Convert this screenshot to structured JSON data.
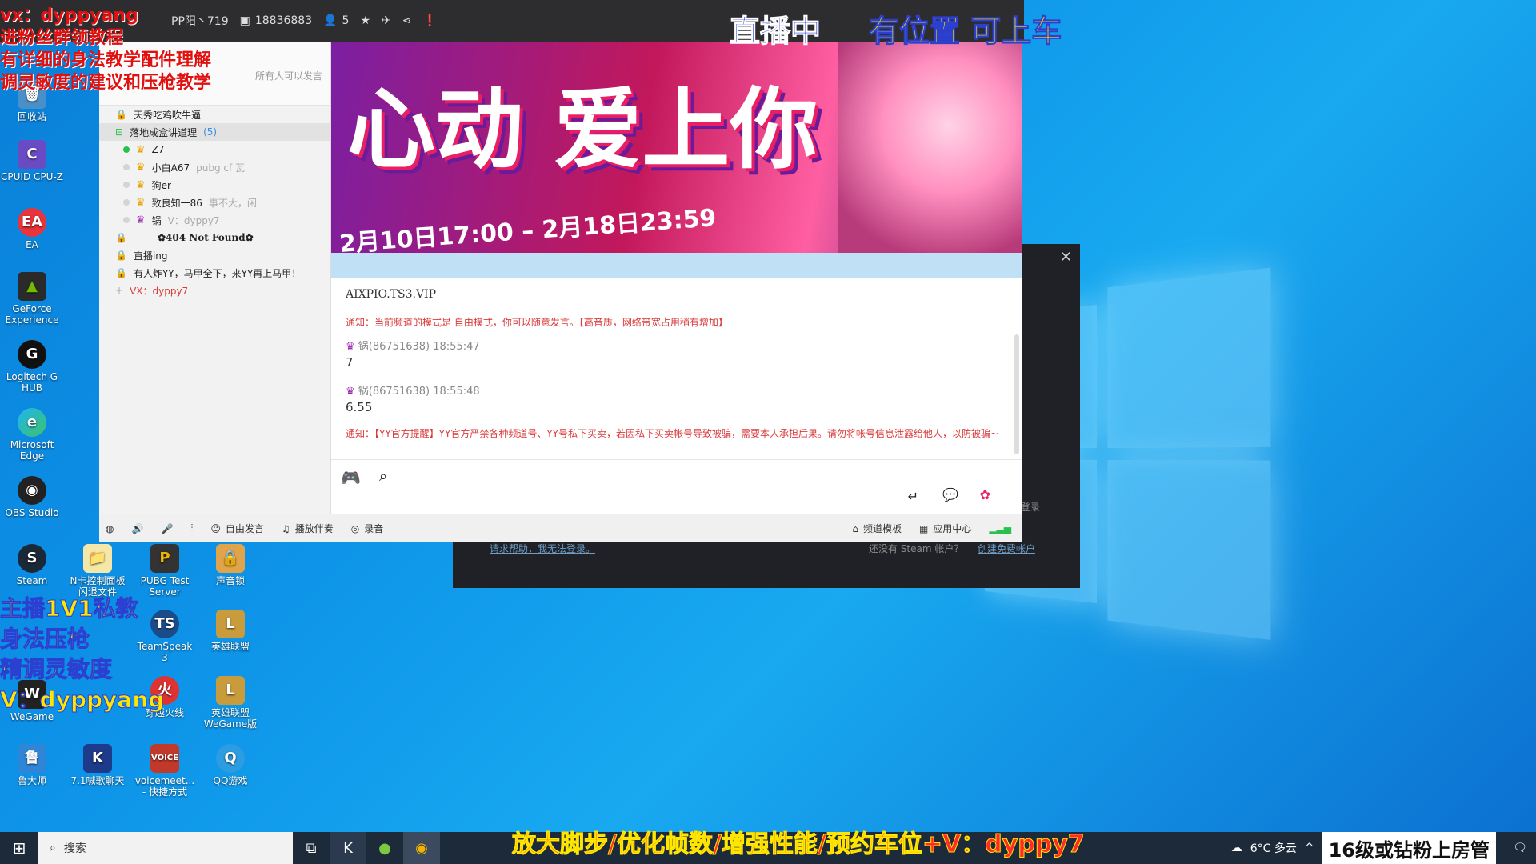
{
  "overlay": {
    "red_lines": [
      "vx：dyppyang",
      "进粉丝群领教程",
      "有详细的身法教学配件理解",
      "调灵敏度的建议和压枪教学"
    ],
    "yellow_lines": [
      "主播1V1私教",
      "身法压枪",
      "精调灵敏度",
      "V：dyppyang"
    ],
    "live": "直播中",
    "seat": "有位置 可上车",
    "promo": "放大脚步/优化帧数/增强性能/预约车位+V：dyppy7",
    "rank": "16级或钻粉上房管"
  },
  "topbar": {
    "channel": "PP阳丶719",
    "channel_id": "18836883",
    "user_count": "5"
  },
  "left_panel": {
    "header_note": "所有人可以发言",
    "header_label": "自由模式",
    "top_channels": [
      "天秀吃鸡吹牛逼",
      "落地成盒讲道理"
    ],
    "online_count": "(5)",
    "users": [
      {
        "name": "Z7",
        "note": "",
        "online": true
      },
      {
        "name": "小白A67",
        "note": "pubg cf 瓦",
        "online": false
      },
      {
        "name": "狗er",
        "note": "",
        "online": false
      },
      {
        "name": "致良知一86",
        "note": "事不大，闲",
        "online": false
      },
      {
        "name": "锅",
        "note": "V：dyppy7",
        "online": false
      }
    ],
    "not_found": "✿404 Not Found✿",
    "subchannels": [
      "直播ing",
      "有人炸YY，马甲全下，来YY再上马甲！"
    ],
    "vx_line": "VX：dyppy7"
  },
  "banner": {
    "title": "心动 爱上你",
    "date": "2月10日17:00 – 2月18日23:59"
  },
  "chat": {
    "room": "AIXPIO.TS3.VIP",
    "notice1": "通知：当前频道的模式是 自由模式，你可以随意发言。【高音质，网络带宽占用稍有增加】",
    "messages": [
      {
        "sender": "锅(86751638)",
        "time": "18:55:47",
        "text": "7"
      },
      {
        "sender": "锅(86751638)",
        "time": "18:55:48",
        "text": "6.55"
      }
    ],
    "notice2": "通知：【YY官方提醒】YY官方严禁各种频道号、YY号私下买卖，若因私下买卖帐号导致被骗，需要本人承担后果。请勿将帐号信息泄露给他人，以防被骗~"
  },
  "bottom_bar": {
    "free_speech": "自由发言",
    "play_music": "播放伴奏",
    "record": "录音",
    "template": "频道模板",
    "app_center": "应用中心"
  },
  "steam": {
    "help": "请求帮助，我无法登录。",
    "no_account": "还没有 Steam 帐户？",
    "create": "创建免费帐户",
    "login": "登录"
  },
  "desktop_icons": [
    {
      "label": "回收站",
      "name": "recycle-bin"
    },
    {
      "label": "CPUID CPU-Z",
      "name": "cpuz"
    },
    {
      "label": "EA",
      "name": "ea"
    },
    {
      "label": "GeForce Experience",
      "name": "geforce"
    },
    {
      "label": "Logitech G HUB",
      "name": "logitech"
    },
    {
      "label": "Microsoft Edge",
      "name": "edge"
    },
    {
      "label": "OBS Studio",
      "name": "obs"
    },
    {
      "label": "Steam",
      "name": "steam"
    },
    {
      "label": "WeGame",
      "name": "wegame"
    },
    {
      "label": "鲁大师",
      "name": "ludashi"
    },
    {
      "label": "N卡控制面板闪退文件",
      "name": "nvidia-panel"
    },
    {
      "label": "PUBG Test Server",
      "name": "pubg-test"
    },
    {
      "label": "声音锁",
      "name": "sound-lock"
    },
    {
      "label": "TeamSpeak 3",
      "name": "teamspeak"
    },
    {
      "label": "英雄联盟",
      "name": "lol"
    },
    {
      "label": "穿越火线",
      "name": "cf"
    },
    {
      "label": "英雄联盟WeGame版",
      "name": "lol-wegame"
    },
    {
      "label": "7.1喊歌聊天",
      "name": "kuhan"
    },
    {
      "label": "voicemeet... - 快捷方式",
      "name": "voicemeeter"
    },
    {
      "label": "QQ游戏",
      "name": "qqgame"
    }
  ],
  "taskbar": {
    "search": "搜索",
    "weather": "6°C 多云"
  }
}
